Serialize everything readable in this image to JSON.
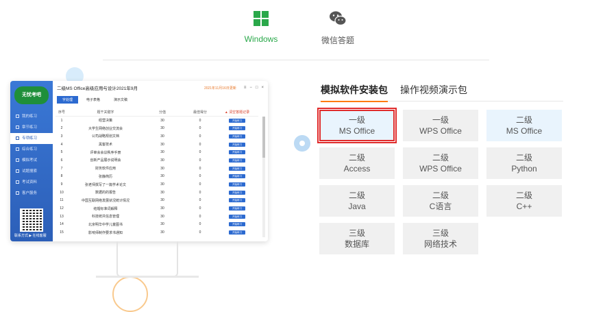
{
  "platforms": [
    {
      "label": "Windows",
      "icon": "windows-icon",
      "color": "#2aa84a"
    },
    {
      "label": "微信答题",
      "icon": "wechat-icon",
      "color": "#555555"
    }
  ],
  "app": {
    "logo": "无忧考吧",
    "title": "二级MS Office高级应用与设计2021年9月",
    "date": "2021年11月16日更新",
    "sidebar": [
      "我的练习",
      "章节练习",
      "专项练习",
      "综合练习",
      "模拟考试",
      "试题搜索",
      "考试资料",
      "客户服务"
    ],
    "sidebar_footer": "联系方式 ▶ 在线客服",
    "tabs": [
      "字处理",
      "电子表格",
      "演示文稿"
    ],
    "table": {
      "headers": [
        "序号",
        "题干关键字",
        "分值",
        "最佳得分",
        "▲ 清空答题记录"
      ],
      "rows": [
        {
          "n": "1",
          "k": "经营决策",
          "s": "30",
          "b": "0",
          "a": "开始练习"
        },
        {
          "n": "2",
          "k": "大学生网络创业交流会",
          "s": "30",
          "b": "0",
          "a": "开始练习"
        },
        {
          "n": "3",
          "k": "公司战略规划文档",
          "s": "30",
          "b": "0",
          "a": "开始练习"
        },
        {
          "n": "4",
          "k": "黑客技术",
          "s": "30",
          "b": "0",
          "a": "开始练习"
        },
        {
          "n": "5",
          "k": "评审会会议秩序手册",
          "s": "30",
          "b": "0",
          "a": "开始练习"
        },
        {
          "n": "6",
          "k": "创新产品展示说明会",
          "s": "30",
          "b": "0",
          "a": "开始练习"
        },
        {
          "n": "7",
          "k": "财务软件应用",
          "s": "30",
          "b": "0",
          "a": "开始练习"
        },
        {
          "n": "8",
          "k": "张静简历",
          "s": "30",
          "b": "0",
          "a": "开始练习"
        },
        {
          "n": "9",
          "k": "张老师撰写了一篇学术论文",
          "s": "30",
          "b": "0",
          "a": "开始练习"
        },
        {
          "n": "10",
          "k": "数据的的报告",
          "s": "30",
          "b": "0",
          "a": "开始练习"
        },
        {
          "n": "11",
          "k": "中国互联网络发展状况统计情况",
          "s": "30",
          "b": "0",
          "a": "开始练习"
        },
        {
          "n": "12",
          "k": "结婚标准词解释",
          "s": "30",
          "b": "0",
          "a": "开始练习"
        },
        {
          "n": "13",
          "k": "科技统共信息管理",
          "s": "30",
          "b": "0",
          "a": "开始练习"
        },
        {
          "n": "14",
          "k": "北京明华中学儿童图书",
          "s": "30",
          "b": "0",
          "a": "开始练习"
        },
        {
          "n": "15",
          "k": "影响师制作要求书通知",
          "s": "30",
          "b": "0",
          "a": "开始练习"
        }
      ]
    }
  },
  "pkg_tabs": [
    "模拟软件安装包",
    "操作视频演示包"
  ],
  "packages": [
    {
      "level": "一级",
      "name": "MS Office",
      "state": "selected"
    },
    {
      "level": "一级",
      "name": "WPS Office",
      "state": "normal"
    },
    {
      "level": "二级",
      "name": "MS Office",
      "state": "blue"
    },
    {
      "level": "二级",
      "name": "Access",
      "state": "normal"
    },
    {
      "level": "二级",
      "name": "WPS Office",
      "state": "normal"
    },
    {
      "level": "二级",
      "name": "Python",
      "state": "normal"
    },
    {
      "level": "二级",
      "name": "Java",
      "state": "normal"
    },
    {
      "level": "二级",
      "name": "C语言",
      "state": "normal"
    },
    {
      "level": "二级",
      "name": "C++",
      "state": "normal"
    },
    {
      "level": "三级",
      "name": "数据库",
      "state": "normal"
    },
    {
      "level": "三级",
      "name": "网络技术",
      "state": "normal"
    }
  ]
}
